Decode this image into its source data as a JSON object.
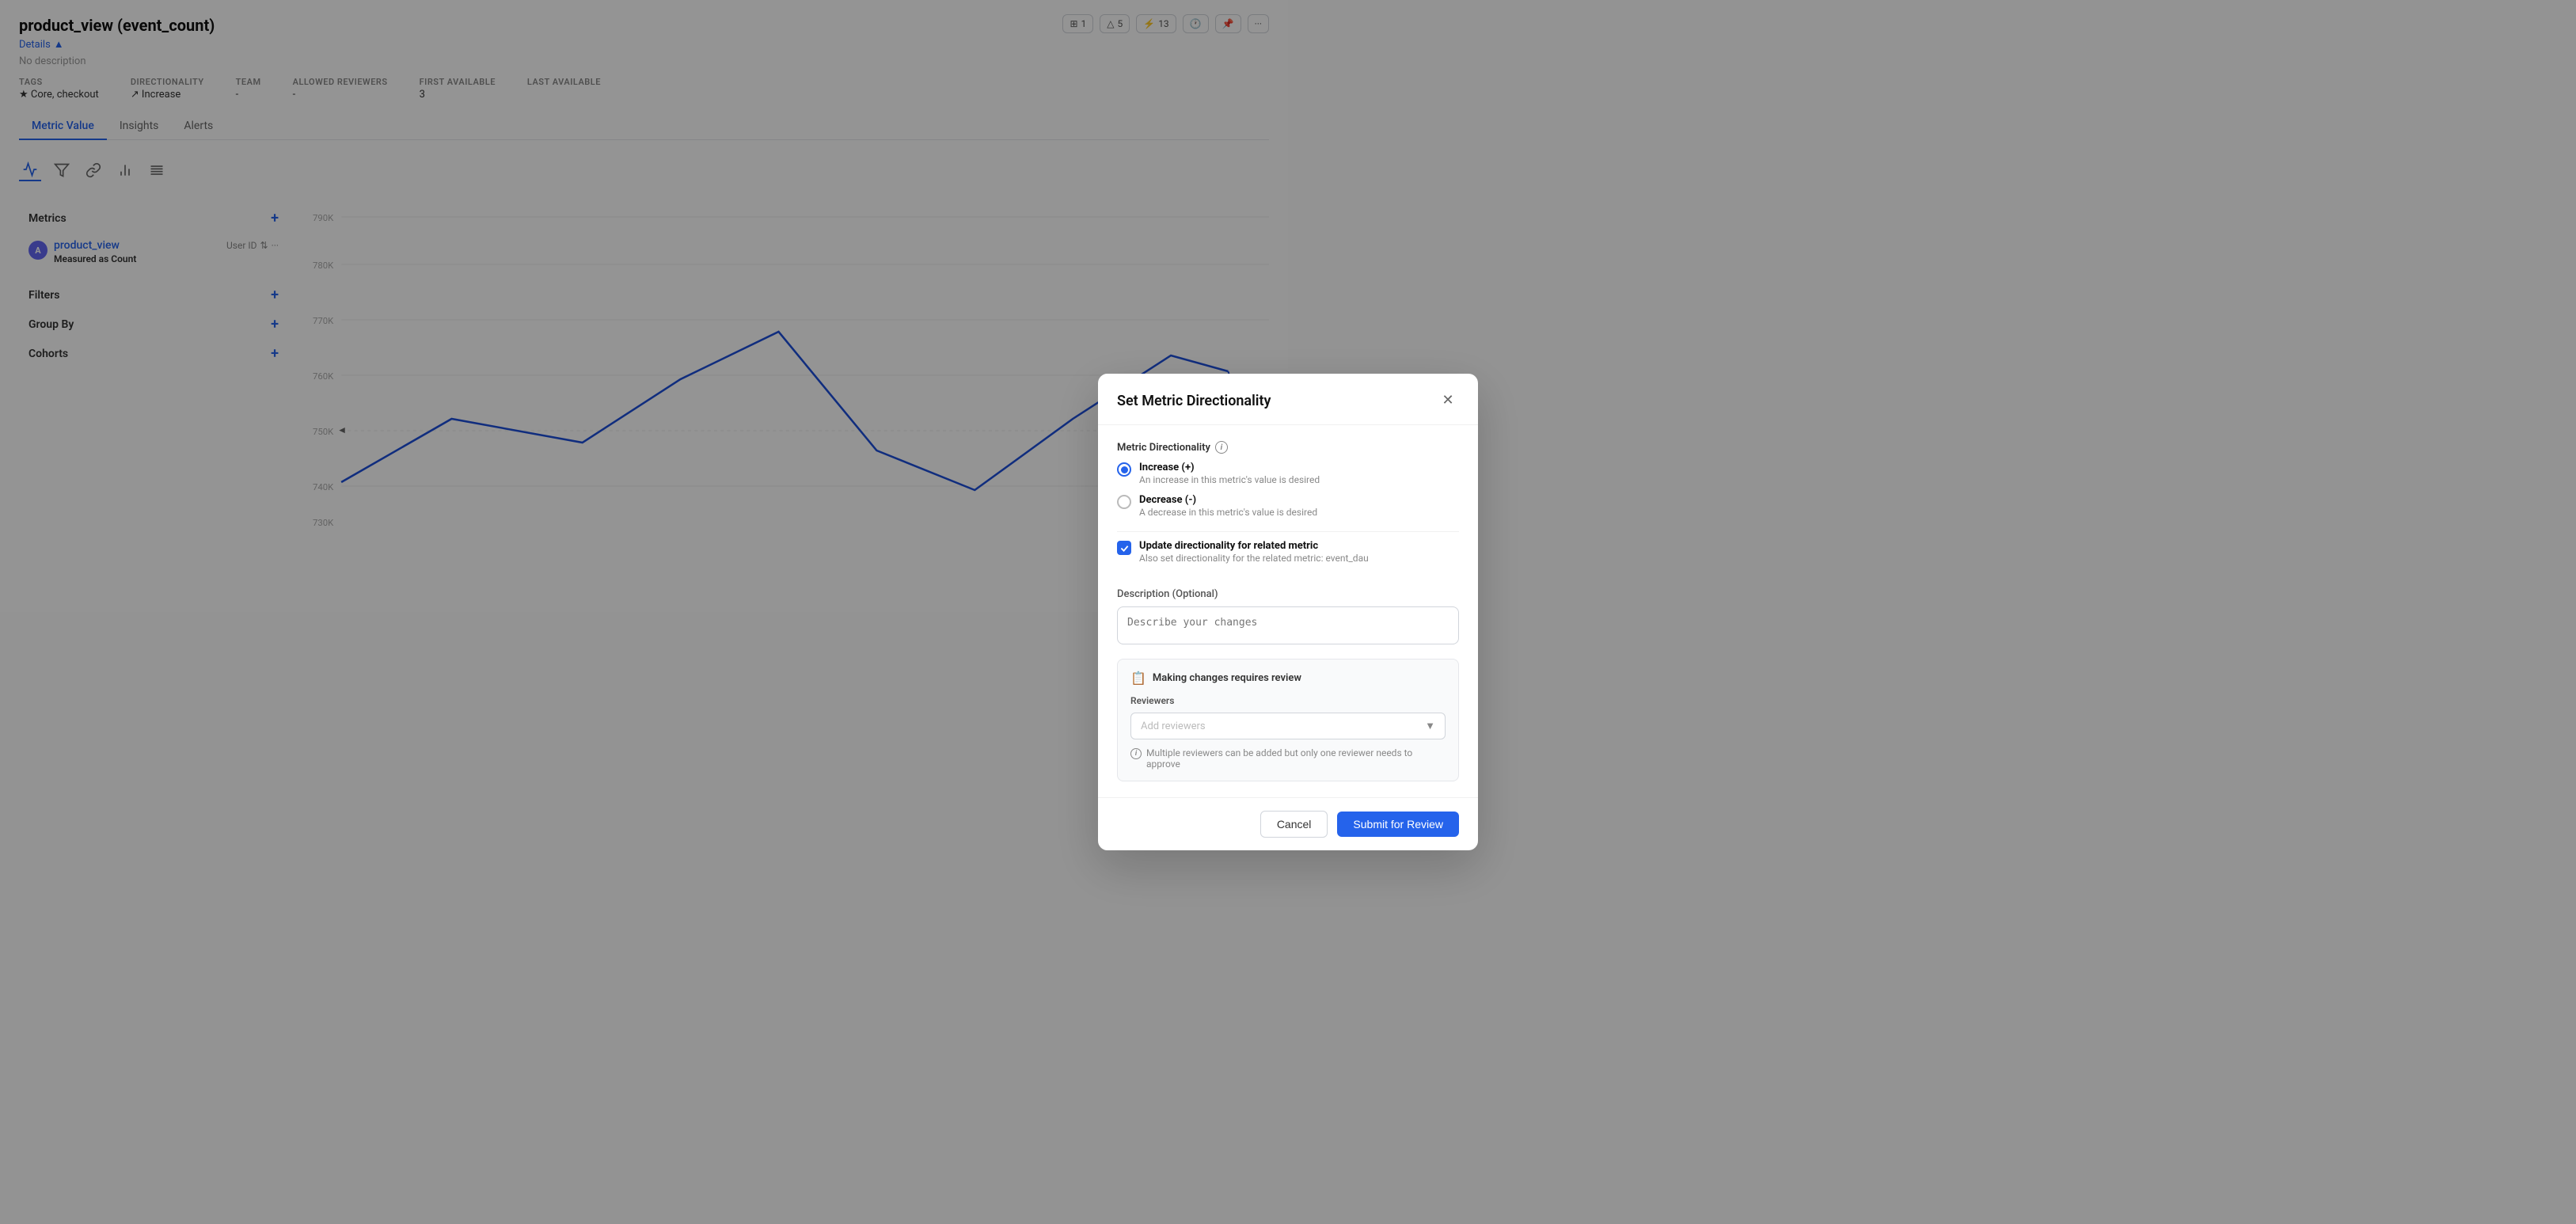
{
  "page": {
    "title": "product_view (event_count)",
    "details_label": "Details",
    "description": "No description",
    "meta": {
      "tags_label": "TAGS",
      "tags_value": "★ Core, checkout",
      "directionality_label": "DIRECTIONALITY",
      "directionality_value": "↗ Increase",
      "team_label": "TEAM",
      "team_value": "-",
      "allowed_reviewers_label": "ALLOWED REVIEWERS",
      "allowed_reviewers_value": "-",
      "first_available_label": "FIRST AVAILABLE",
      "first_available_value": "3",
      "last_available_label": "LAST AVAILABLE",
      "last_available_value": ""
    },
    "badges": [
      {
        "icon": "grid-icon",
        "count": "1"
      },
      {
        "icon": "user-icon",
        "count": "5"
      },
      {
        "icon": "branch-icon",
        "count": "13"
      }
    ]
  },
  "tabs": [
    {
      "label": "Metric Value",
      "active": true
    },
    {
      "label": "Insights",
      "active": false
    },
    {
      "label": "Alerts",
      "active": false
    }
  ],
  "sidebar": {
    "metrics_label": "Metrics",
    "metric_name": "product_view",
    "metric_user_label": "User ID",
    "metric_measured_label": "Measured as",
    "metric_measured_value": "Count",
    "filters_label": "Filters",
    "group_by_label": "Group By",
    "cohorts_label": "Cohorts"
  },
  "modal": {
    "title": "Set Metric Directionality",
    "directionality_label": "Metric Directionality",
    "increase_label": "Increase (+)",
    "increase_desc": "An increase in this metric's value is desired",
    "decrease_label": "Decrease (-)",
    "decrease_desc": "A decrease in this metric's value is desired",
    "checkbox_label": "Update directionality for related metric",
    "checkbox_desc": "Also set directionality for the related metric: event_dau",
    "description_label": "Description (Optional)",
    "description_placeholder": "Describe your changes",
    "review_title": "Making changes requires review",
    "reviewers_label": "Reviewers",
    "reviewers_placeholder": "Add reviewers",
    "reviewers_hint": "Multiple reviewers can be added but only one reviewer needs to approve",
    "cancel_label": "Cancel",
    "submit_label": "Submit for Review"
  }
}
